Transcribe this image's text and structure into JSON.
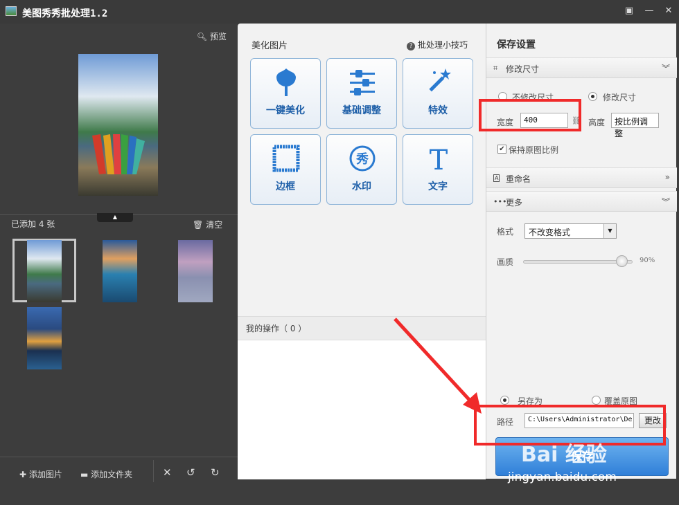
{
  "titlebar": {
    "title": "美图秀秀批处理1.2",
    "icons": [
      "image-app-icon",
      "chat-icon",
      "minimize-icon",
      "close-icon"
    ]
  },
  "left": {
    "preview_label": "预览",
    "added_label": "已添加 4 张",
    "clear_label": "清空",
    "bottom": {
      "add_image": "添加图片",
      "add_folder": "添加文件夹"
    }
  },
  "center": {
    "title": "美化图片",
    "tips": "批处理小技巧",
    "tools": [
      "一键美化",
      "基础调整",
      "特效",
      "边框",
      "水印",
      "文字"
    ],
    "watermark_glyph": "秀",
    "text_glyph": "T",
    "ops_title": "我的操作（ 0 ）"
  },
  "right": {
    "title": "保存设置",
    "resize_section": "修改尺寸",
    "no_resize": "不修改尺寸",
    "resize": "修改尺寸",
    "width_label": "宽度",
    "width_value": "400",
    "height_label": "高度",
    "height_value": "按比例调整",
    "keep_ratio": "保持原图比例",
    "rename_section": "重命名",
    "more_section": "更多",
    "format_label": "格式",
    "format_value": "不改变格式",
    "quality_label": "画质",
    "quality_value": "90%",
    "quality_fraction": 0.9,
    "save_as": "另存为",
    "overwrite": "覆盖原图",
    "path_label": "路径",
    "path_value": "C:\\Users\\Administrator\\De:",
    "change_button": "更改",
    "save_button": "保存"
  },
  "watermark": {
    "brand": "Bai 经验",
    "url": "jingyan.baidu.com"
  },
  "colors": {
    "accent": "#2f7fd8",
    "highlight_red": "#f02a2a",
    "tool_text": "#1e5fa8"
  }
}
